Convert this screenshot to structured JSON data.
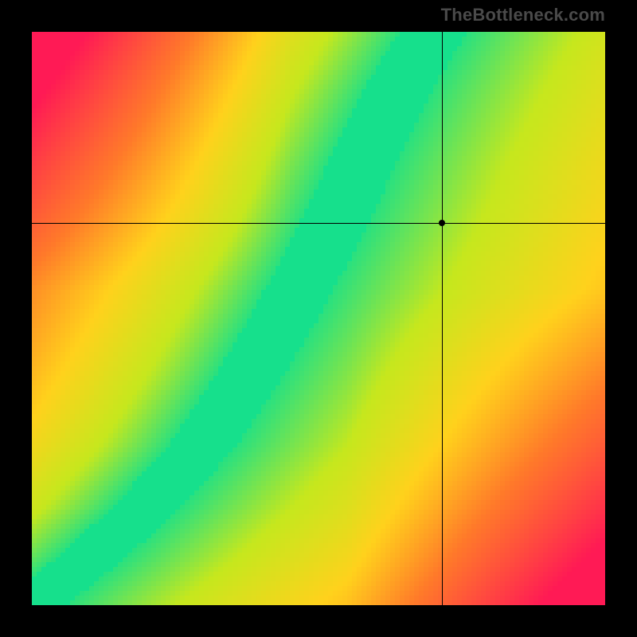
{
  "watermark": "TheBottleneck.com",
  "chart_data": {
    "type": "heatmap",
    "title": "",
    "xlabel": "",
    "ylabel": "",
    "xlim": [
      0,
      1
    ],
    "ylim": [
      0,
      1
    ],
    "grid": false,
    "legend": false,
    "description": "Bottleneck heatmap: green diagonal ridge indicates balanced CPU/GPU pairing; red regions indicate severe bottleneck; yellow/orange indicate moderate imbalance. A black crosshair and dot mark the user's current CPU/GPU position.",
    "crosshair": {
      "x": 0.715,
      "y": 0.333
    },
    "marker": {
      "x": 0.715,
      "y": 0.333
    },
    "ridge": {
      "comment": "Approximate green ridge center as (x, y_from_top_fraction) control points, read off the image.",
      "points": [
        [
          0.0,
          1.0
        ],
        [
          0.1,
          0.92
        ],
        [
          0.2,
          0.83
        ],
        [
          0.3,
          0.72
        ],
        [
          0.38,
          0.6
        ],
        [
          0.45,
          0.48
        ],
        [
          0.52,
          0.35
        ],
        [
          0.58,
          0.22
        ],
        [
          0.64,
          0.1
        ],
        [
          0.7,
          0.0
        ]
      ],
      "width_frac": 0.06
    },
    "colors": {
      "red": "#ff1a55",
      "orange": "#ff7a2a",
      "yellow": "#ffd21c",
      "lime": "#c6e81e",
      "green": "#16e08c"
    },
    "pixelation": 120
  }
}
